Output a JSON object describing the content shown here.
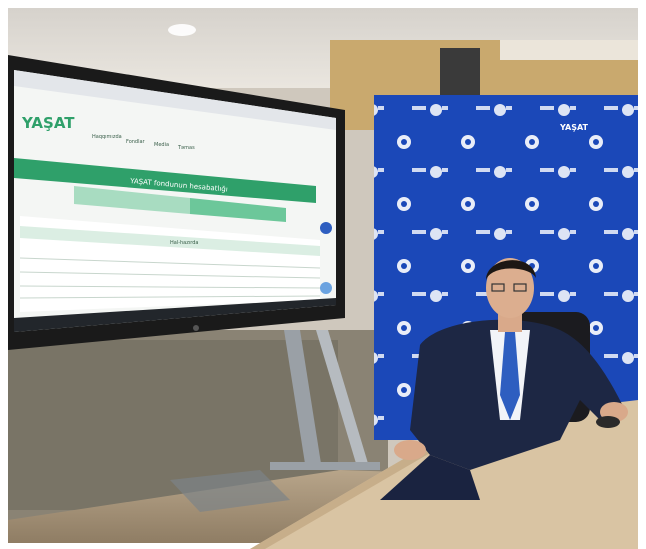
{
  "screen": {
    "logo_text": "YAŞAT",
    "nav_items": [
      "Haqqımızda",
      "Fondlar",
      "Media",
      "Təmas"
    ],
    "header_banner": "YAŞAT fondunun hesabatlığı",
    "table_caption": "Hal-hazırda",
    "taskbar_icons": [
      "windows-icon",
      "search-icon",
      "chrome-icon"
    ]
  },
  "backdrop": {
    "brand_mark": "YAŞAT"
  },
  "colors": {
    "wall_blue": "#1b48b8",
    "screen_green": "#2fa06a",
    "table_wood": "#d9c4a3",
    "suit_navy": "#1d2744",
    "tie_blue": "#2e5ec0"
  }
}
